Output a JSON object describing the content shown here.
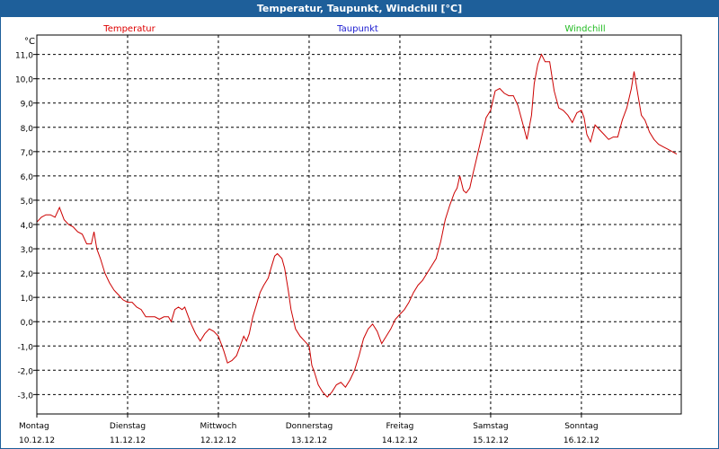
{
  "window": {
    "title": "Temperatur, Taupunkt, Windchill [°C]"
  },
  "chart_data": {
    "type": "line",
    "title": "Temperatur, Taupunkt, Windchill [°C]",
    "unit_label": "°C",
    "ylim": [
      -3.8,
      11.8
    ],
    "yticks": [
      "11,0",
      "10,0",
      "9,0",
      "8,0",
      "7,0",
      "6,0",
      "5,0",
      "4,0",
      "3,0",
      "2,0",
      "1,0",
      "0,0",
      "-1,0",
      "-2,0",
      "-3,0"
    ],
    "ytick_values": [
      11,
      10,
      9,
      8,
      7,
      6,
      5,
      4,
      3,
      2,
      1,
      0,
      -1,
      -2,
      -3
    ],
    "days": [
      {
        "weekday": "Montag",
        "date": "10.12.12"
      },
      {
        "weekday": "Dienstag",
        "date": "11.12.12"
      },
      {
        "weekday": "Mittwoch",
        "date": "12.12.12"
      },
      {
        "weekday": "Donnerstag",
        "date": "13.12.12"
      },
      {
        "weekday": "Freitag",
        "date": "14.12.12"
      },
      {
        "weekday": "Samstag",
        "date": "15.12.12"
      },
      {
        "weekday": "Sonntag",
        "date": "16.12.12"
      }
    ],
    "xlim": [
      0,
      7.1
    ],
    "grid": true,
    "legend": [
      {
        "name": "Temperatur",
        "color": "#dd0000"
      },
      {
        "name": "Taupunkt",
        "color": "#1a1ad0"
      },
      {
        "name": "Windchill",
        "color": "#22bb22"
      }
    ],
    "series": [
      {
        "name": "Temperatur",
        "color": "#cc0000",
        "points": [
          [
            0.0,
            4.1
          ],
          [
            0.05,
            4.3
          ],
          [
            0.1,
            4.4
          ],
          [
            0.15,
            4.4
          ],
          [
            0.2,
            4.3
          ],
          [
            0.25,
            4.7
          ],
          [
            0.3,
            4.2
          ],
          [
            0.35,
            4.0
          ],
          [
            0.4,
            3.9
          ],
          [
            0.45,
            3.7
          ],
          [
            0.5,
            3.6
          ],
          [
            0.55,
            3.2
          ],
          [
            0.6,
            3.2
          ],
          [
            0.63,
            3.7
          ],
          [
            0.66,
            3.0
          ],
          [
            0.7,
            2.6
          ],
          [
            0.75,
            2.0
          ],
          [
            0.8,
            1.6
          ],
          [
            0.85,
            1.3
          ],
          [
            0.9,
            1.1
          ],
          [
            0.95,
            0.9
          ],
          [
            1.0,
            0.8
          ],
          [
            1.05,
            0.8
          ],
          [
            1.1,
            0.6
          ],
          [
            1.15,
            0.5
          ],
          [
            1.2,
            0.2
          ],
          [
            1.25,
            0.2
          ],
          [
            1.3,
            0.2
          ],
          [
            1.35,
            0.1
          ],
          [
            1.4,
            0.2
          ],
          [
            1.45,
            0.2
          ],
          [
            1.48,
            0.0
          ],
          [
            1.52,
            0.5
          ],
          [
            1.56,
            0.6
          ],
          [
            1.6,
            0.5
          ],
          [
            1.63,
            0.6
          ],
          [
            1.66,
            0.3
          ],
          [
            1.7,
            -0.1
          ],
          [
            1.75,
            -0.5
          ],
          [
            1.8,
            -0.8
          ],
          [
            1.85,
            -0.5
          ],
          [
            1.9,
            -0.3
          ],
          [
            1.95,
            -0.4
          ],
          [
            2.0,
            -0.6
          ],
          [
            2.03,
            -0.9
          ],
          [
            2.06,
            -1.2
          ],
          [
            2.1,
            -1.7
          ],
          [
            2.15,
            -1.6
          ],
          [
            2.2,
            -1.4
          ],
          [
            2.25,
            -0.9
          ],
          [
            2.28,
            -0.6
          ],
          [
            2.31,
            -0.8
          ],
          [
            2.34,
            -0.5
          ],
          [
            2.38,
            0.2
          ],
          [
            2.42,
            0.7
          ],
          [
            2.46,
            1.2
          ],
          [
            2.5,
            1.5
          ],
          [
            2.55,
            1.8
          ],
          [
            2.58,
            2.2
          ],
          [
            2.62,
            2.7
          ],
          [
            2.65,
            2.8
          ],
          [
            2.7,
            2.6
          ],
          [
            2.73,
            2.2
          ],
          [
            2.77,
            1.3
          ],
          [
            2.8,
            0.5
          ],
          [
            2.85,
            -0.3
          ],
          [
            2.9,
            -0.6
          ],
          [
            2.95,
            -0.8
          ],
          [
            3.0,
            -1.0
          ],
          [
            3.03,
            -1.8
          ],
          [
            3.06,
            -2.1
          ],
          [
            3.1,
            -2.6
          ],
          [
            3.15,
            -2.9
          ],
          [
            3.2,
            -3.1
          ],
          [
            3.25,
            -2.9
          ],
          [
            3.3,
            -2.6
          ],
          [
            3.35,
            -2.5
          ],
          [
            3.4,
            -2.7
          ],
          [
            3.45,
            -2.4
          ],
          [
            3.5,
            -2.0
          ],
          [
            3.55,
            -1.4
          ],
          [
            3.6,
            -0.7
          ],
          [
            3.65,
            -0.3
          ],
          [
            3.7,
            -0.1
          ],
          [
            3.75,
            -0.4
          ],
          [
            3.8,
            -0.9
          ],
          [
            3.85,
            -0.6
          ],
          [
            3.9,
            -0.3
          ],
          [
            3.95,
            0.1
          ],
          [
            4.0,
            0.3
          ],
          [
            4.05,
            0.5
          ],
          [
            4.1,
            0.8
          ],
          [
            4.15,
            1.2
          ],
          [
            4.2,
            1.5
          ],
          [
            4.25,
            1.7
          ],
          [
            4.3,
            2.0
          ],
          [
            4.35,
            2.3
          ],
          [
            4.4,
            2.6
          ],
          [
            4.45,
            3.3
          ],
          [
            4.5,
            4.2
          ],
          [
            4.55,
            4.8
          ],
          [
            4.6,
            5.3
          ],
          [
            4.63,
            5.5
          ],
          [
            4.66,
            6.0
          ],
          [
            4.7,
            5.4
          ],
          [
            4.73,
            5.3
          ],
          [
            4.77,
            5.5
          ],
          [
            4.8,
            6.0
          ],
          [
            4.85,
            6.8
          ],
          [
            4.9,
            7.6
          ],
          [
            4.95,
            8.4
          ],
          [
            5.0,
            8.7
          ],
          [
            5.05,
            9.5
          ],
          [
            5.1,
            9.6
          ],
          [
            5.15,
            9.4
          ],
          [
            5.2,
            9.3
          ],
          [
            5.25,
            9.3
          ],
          [
            5.3,
            8.9
          ],
          [
            5.35,
            8.2
          ],
          [
            5.4,
            7.5
          ],
          [
            5.45,
            8.5
          ],
          [
            5.48,
            9.8
          ],
          [
            5.52,
            10.6
          ],
          [
            5.56,
            11.0
          ],
          [
            5.6,
            10.7
          ],
          [
            5.65,
            10.7
          ],
          [
            5.7,
            9.5
          ],
          [
            5.75,
            8.8
          ],
          [
            5.8,
            8.7
          ],
          [
            5.85,
            8.5
          ],
          [
            5.9,
            8.2
          ],
          [
            5.95,
            8.6
          ],
          [
            6.0,
            8.7
          ],
          [
            6.03,
            8.4
          ],
          [
            6.06,
            7.7
          ],
          [
            6.1,
            7.4
          ],
          [
            6.15,
            8.1
          ],
          [
            6.2,
            7.9
          ],
          [
            6.25,
            7.7
          ],
          [
            6.3,
            7.5
          ],
          [
            6.35,
            7.6
          ],
          [
            6.4,
            7.6
          ],
          [
            6.45,
            8.3
          ],
          [
            6.5,
            8.8
          ],
          [
            6.55,
            9.6
          ],
          [
            6.58,
            10.3
          ],
          [
            6.62,
            9.4
          ],
          [
            6.66,
            8.5
          ],
          [
            6.7,
            8.3
          ],
          [
            6.75,
            7.8
          ],
          [
            6.8,
            7.5
          ],
          [
            6.85,
            7.3
          ],
          [
            6.9,
            7.2
          ],
          [
            6.95,
            7.1
          ],
          [
            7.0,
            7.0
          ],
          [
            7.05,
            6.9
          ]
        ]
      }
    ]
  }
}
